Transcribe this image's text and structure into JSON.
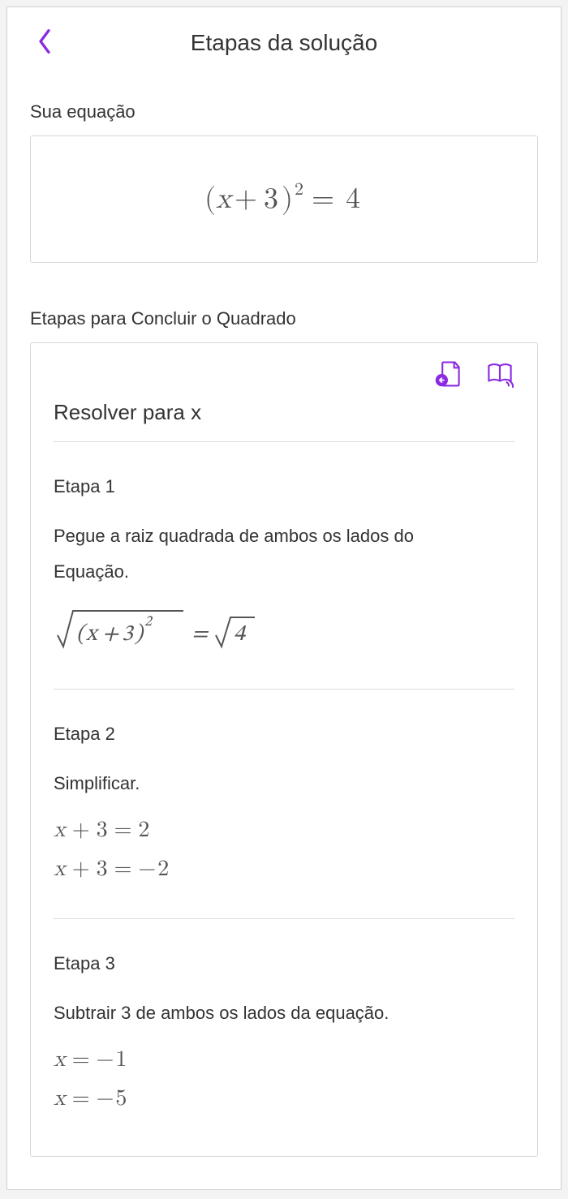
{
  "header": {
    "title": "Etapas da solução"
  },
  "section_equation_label": "Sua equação",
  "equation": {
    "lhs_base": "(x + 3)",
    "lhs_exp": "2",
    "op": "=",
    "rhs": "4",
    "full": "(x + 3)^2 = 4"
  },
  "section_steps_label": "Etapas para Concluir o Quadrado",
  "solve_title": "Resolver para x",
  "steps": [
    {
      "label": "Etapa 1",
      "description_line1": "Pegue a raiz quadrada de ambos os lados do",
      "description_line2": "Equação.",
      "math": [
        "√((x + 3)^2) = √4"
      ]
    },
    {
      "label": "Etapa 2",
      "description_line1": "Simplificar.",
      "math": [
        "x + 3 = 2",
        "x + 3 = -2"
      ]
    },
    {
      "label": "Etapa 3",
      "description_line1": "Subtrair 3 de ambos os lados da equação.",
      "math": [
        "x = -1",
        "x = -5"
      ]
    }
  ],
  "icons": {
    "back": "chevron-left-icon",
    "insert_page": "page-insert-icon",
    "read_aloud": "book-audio-icon"
  },
  "accent_color": "#8a2be2"
}
